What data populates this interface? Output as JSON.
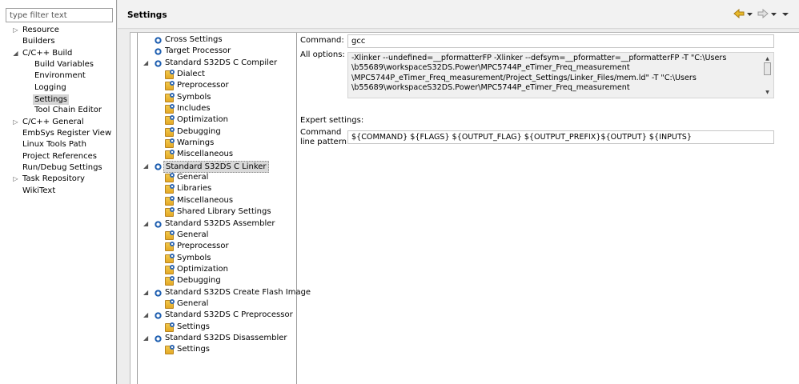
{
  "filter": {
    "placeholder": "type filter text"
  },
  "nav": {
    "items": [
      {
        "label": "Resource",
        "expand": "▷",
        "child": false
      },
      {
        "label": "Builders",
        "expand": "",
        "child": false
      },
      {
        "label": "C/C++ Build",
        "expand": "◢",
        "child": false
      },
      {
        "label": "Build Variables",
        "expand": "",
        "child": true
      },
      {
        "label": "Environment",
        "expand": "",
        "child": true
      },
      {
        "label": "Logging",
        "expand": "",
        "child": true
      },
      {
        "label": "Settings",
        "expand": "",
        "child": true,
        "selected": true
      },
      {
        "label": "Tool Chain Editor",
        "expand": "",
        "child": true
      },
      {
        "label": "C/C++ General",
        "expand": "▷",
        "child": false
      },
      {
        "label": "EmbSys Register View",
        "expand": "",
        "child": false
      },
      {
        "label": "Linux Tools Path",
        "expand": "",
        "child": false
      },
      {
        "label": "Project References",
        "expand": "",
        "child": false
      },
      {
        "label": "Run/Debug Settings",
        "expand": "",
        "child": false
      },
      {
        "label": "Task Repository",
        "expand": "▷",
        "child": false
      },
      {
        "label": "WikiText",
        "expand": "",
        "child": false
      }
    ]
  },
  "header": {
    "title": "Settings",
    "back_icon": "back-arrow-icon",
    "forward_icon": "forward-arrow-icon",
    "accent": "#d9a520"
  },
  "tool_tree": {
    "items": [
      {
        "label": "Cross Settings",
        "level": "top",
        "icon": "gear",
        "expand": ""
      },
      {
        "label": "Target Processor",
        "level": "top",
        "icon": "gear",
        "expand": ""
      },
      {
        "label": "Standard S32DS C Compiler",
        "level": "top",
        "icon": "gear",
        "expand": "◢"
      },
      {
        "label": "Dialect",
        "level": "sub",
        "icon": "folder",
        "expand": ""
      },
      {
        "label": "Preprocessor",
        "level": "sub",
        "icon": "folder",
        "expand": ""
      },
      {
        "label": "Symbols",
        "level": "sub",
        "icon": "folder",
        "expand": ""
      },
      {
        "label": "Includes",
        "level": "sub",
        "icon": "folder",
        "expand": ""
      },
      {
        "label": "Optimization",
        "level": "sub",
        "icon": "folder",
        "expand": ""
      },
      {
        "label": "Debugging",
        "level": "sub",
        "icon": "folder",
        "expand": ""
      },
      {
        "label": "Warnings",
        "level": "sub",
        "icon": "folder",
        "expand": ""
      },
      {
        "label": "Miscellaneous",
        "level": "sub",
        "icon": "folder",
        "expand": ""
      },
      {
        "label": "Standard S32DS C Linker",
        "level": "top",
        "icon": "gear",
        "expand": "◢",
        "selected": true
      },
      {
        "label": "General",
        "level": "sub",
        "icon": "folder",
        "expand": ""
      },
      {
        "label": "Libraries",
        "level": "sub",
        "icon": "folder",
        "expand": ""
      },
      {
        "label": "Miscellaneous",
        "level": "sub",
        "icon": "folder",
        "expand": ""
      },
      {
        "label": "Shared Library Settings",
        "level": "sub",
        "icon": "folder",
        "expand": ""
      },
      {
        "label": "Standard S32DS Assembler",
        "level": "top",
        "icon": "gear",
        "expand": "◢"
      },
      {
        "label": "General",
        "level": "sub",
        "icon": "folder",
        "expand": ""
      },
      {
        "label": "Preprocessor",
        "level": "sub",
        "icon": "folder",
        "expand": ""
      },
      {
        "label": "Symbols",
        "level": "sub",
        "icon": "folder",
        "expand": ""
      },
      {
        "label": "Optimization",
        "level": "sub",
        "icon": "folder",
        "expand": ""
      },
      {
        "label": "Debugging",
        "level": "sub",
        "icon": "folder",
        "expand": ""
      },
      {
        "label": "Standard S32DS Create Flash Image",
        "level": "top",
        "icon": "gear",
        "expand": "◢"
      },
      {
        "label": "General",
        "level": "sub",
        "icon": "folder",
        "expand": ""
      },
      {
        "label": "Standard S32DS C Preprocessor",
        "level": "top",
        "icon": "gear",
        "expand": "◢"
      },
      {
        "label": "Settings",
        "level": "sub",
        "icon": "folder",
        "expand": ""
      },
      {
        "label": "Standard S32DS Disassembler",
        "level": "top",
        "icon": "gear",
        "expand": "◢"
      },
      {
        "label": "Settings",
        "level": "sub",
        "icon": "folder",
        "expand": ""
      }
    ]
  },
  "props": {
    "command_label": "Command:",
    "command_value": "gcc",
    "all_options_label": "All options:",
    "all_options_lines": [
      "-Xlinker --undefined=__pformatterFP -Xlinker --defsym=__pformatter=__pformatterFP -T \"C:\\Users",
      "\\b55689\\workspaceS32DS.Power\\MPC5744P_eTimer_Freq_measurement",
      "\\MPC5744P_eTimer_Freq_measurement/Project_Settings/Linker_Files/mem.ld\" -T \"C:\\Users",
      "\\b55689\\workspaceS32DS.Power\\MPC5744P_eTimer_Freq_measurement"
    ],
    "expert_label": "Expert settings:",
    "pattern_label_1": "Command",
    "pattern_label_2": "line pattern:",
    "pattern_value": "${COMMAND} ${FLAGS} ${OUTPUT_FLAG} ${OUTPUT_PREFIX}${OUTPUT} ${INPUTS}"
  }
}
